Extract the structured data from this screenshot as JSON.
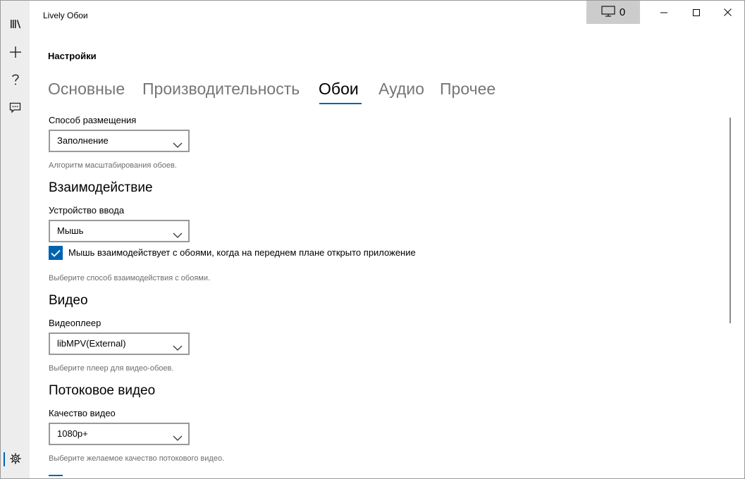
{
  "window": {
    "title": "Lively Обои",
    "screen_count": "0"
  },
  "sidebar": {
    "items": [
      {
        "name": "library",
        "icon": "library-icon"
      },
      {
        "name": "add",
        "icon": "plus-icon"
      },
      {
        "name": "help",
        "icon": "question-icon"
      },
      {
        "name": "feedback",
        "icon": "chat-icon"
      }
    ],
    "settings_icon": "gear-icon"
  },
  "page": {
    "title": "Настройки"
  },
  "tabs": [
    {
      "label": "Основные",
      "active": false
    },
    {
      "label": "Производительность",
      "active": false
    },
    {
      "label": "Обои",
      "active": true
    },
    {
      "label": "Аудио",
      "active": false
    },
    {
      "label": "Прочее",
      "active": false
    }
  ],
  "placement": {
    "label": "Способ размещения",
    "value": "Заполнение",
    "hint": "Алгоритм масштабирования обоев."
  },
  "interaction": {
    "title": "Взаимодействие",
    "input_label": "Устройство ввода",
    "input_value": "Мышь",
    "checkbox_label": "Мышь взаимодействует с обоями, когда на переднем плане открыто приложение",
    "checkbox_checked": true,
    "hint": "Выберите способ взаимодействия с обоями."
  },
  "video": {
    "title": "Видео",
    "player_label": "Видеоплеер",
    "player_value": "libMPV(External)",
    "hint": "Выберите плеер для видео-обоев."
  },
  "streaming": {
    "title": "Потоковое видео",
    "quality_label": "Качество видео",
    "quality_value": "1080p+",
    "hint": "Выберите желаемое качество потокового видео."
  },
  "colors": {
    "accent": "#0063b1",
    "sidebar_bg": "#ededed",
    "hint_text": "#6d6d6d"
  }
}
